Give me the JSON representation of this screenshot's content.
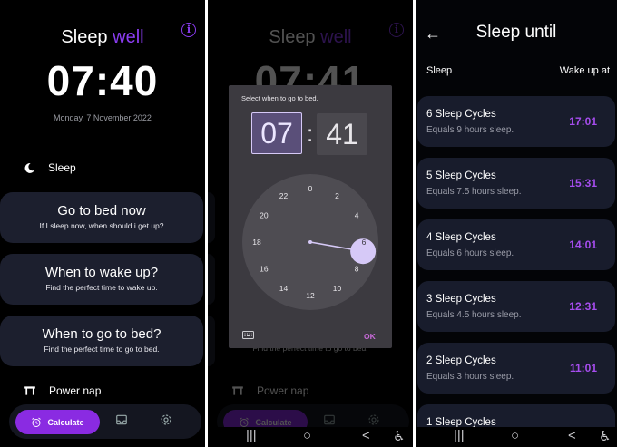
{
  "screen1": {
    "title_part1": "Sleep",
    "title_part2": "well",
    "time": "07:40",
    "date": "Monday, 7 November 2022",
    "sleep_label": "Sleep",
    "cards": [
      {
        "title": "Go to bed now",
        "subtitle": "If I sleep now, when should i get up?"
      },
      {
        "title": "When to wake up?",
        "subtitle": "Find the perfect time to wake up."
      },
      {
        "title": "When to go to bed?",
        "subtitle": "Find the perfect time to go to bed."
      }
    ],
    "power_nap_label": "Power nap",
    "calculate_label": "Calculate"
  },
  "screen2": {
    "title_part1": "Sleep",
    "title_part2": "well",
    "time": "07:41",
    "dialog_title": "Select when to go to bed.",
    "hour": "07",
    "minute": "41",
    "clock_numbers": [
      "0",
      "2",
      "4",
      "6",
      "8",
      "10",
      "12",
      "14",
      "16",
      "18",
      "20",
      "22"
    ],
    "selected_hour": 6,
    "ok_label": "OK",
    "bg_subtitle": "Find the perfect time to go to bed.",
    "power_nap_label": "Power nap",
    "calculate_label": "Calculate"
  },
  "screen3": {
    "title": "Sleep until",
    "col_sleep": "Sleep",
    "col_wake": "Wake up at",
    "cycles": [
      {
        "title": "6 Sleep Cycles",
        "subtitle": "Equals 9 hours sleep.",
        "wake": "17:01"
      },
      {
        "title": "5 Sleep Cycles",
        "subtitle": "Equals 7.5 hours sleep.",
        "wake": "15:31"
      },
      {
        "title": "4 Sleep Cycles",
        "subtitle": "Equals 6 hours sleep.",
        "wake": "14:01"
      },
      {
        "title": "3 Sleep Cycles",
        "subtitle": "Equals 4.5 hours sleep.",
        "wake": "12:31"
      },
      {
        "title": "2 Sleep Cycles",
        "subtitle": "Equals 3 hours sleep.",
        "wake": "11:01"
      },
      {
        "title": "1 Sleep Cycles",
        "subtitle": "",
        "wake": ""
      }
    ]
  },
  "system_nav": {
    "recents": "|||",
    "home": "○",
    "back": "<",
    "accessibility": "♿"
  },
  "colors": {
    "accent": "#8a2be2",
    "accent_text": "#a64dee",
    "card_bg": "#1c1f2e",
    "picker_accent": "#d6c9f7"
  },
  "icons": [
    "info-icon",
    "moon-icon",
    "power-nap-icon",
    "alarm-icon",
    "inbox-icon",
    "gear-icon",
    "keyboard-icon",
    "back-arrow-icon"
  ]
}
